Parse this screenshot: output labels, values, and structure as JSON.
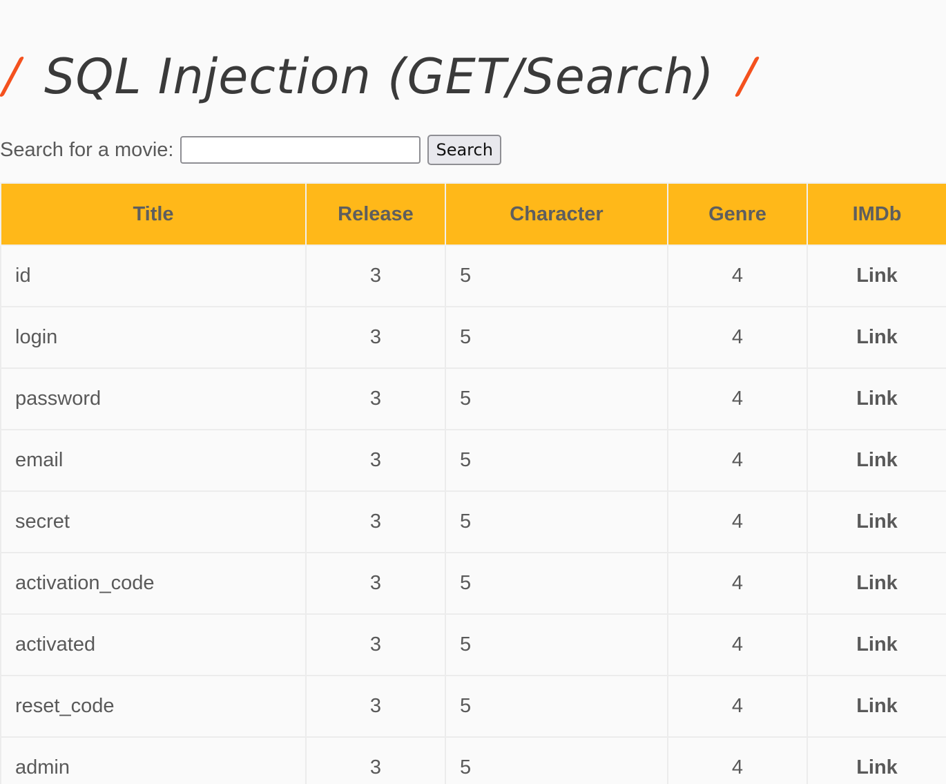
{
  "header": {
    "title": "SQL Injection (GET/Search)"
  },
  "search": {
    "label": "Search for a movie:",
    "value": "",
    "placeholder": "",
    "button_label": "Search"
  },
  "table": {
    "columns": [
      "Title",
      "Release",
      "Character",
      "Genre",
      "IMDb"
    ],
    "rows": [
      {
        "title": "id",
        "release": "3",
        "character": "5",
        "genre": "4",
        "imdb": "Link"
      },
      {
        "title": "login",
        "release": "3",
        "character": "5",
        "genre": "4",
        "imdb": "Link"
      },
      {
        "title": "password",
        "release": "3",
        "character": "5",
        "genre": "4",
        "imdb": "Link"
      },
      {
        "title": "email",
        "release": "3",
        "character": "5",
        "genre": "4",
        "imdb": "Link"
      },
      {
        "title": "secret",
        "release": "3",
        "character": "5",
        "genre": "4",
        "imdb": "Link"
      },
      {
        "title": "activation_code",
        "release": "3",
        "character": "5",
        "genre": "4",
        "imdb": "Link"
      },
      {
        "title": "activated",
        "release": "3",
        "character": "5",
        "genre": "4",
        "imdb": "Link"
      },
      {
        "title": "reset_code",
        "release": "3",
        "character": "5",
        "genre": "4",
        "imdb": "Link"
      },
      {
        "title": "admin",
        "release": "3",
        "character": "5",
        "genre": "4",
        "imdb": "Link"
      }
    ]
  },
  "colors": {
    "accent_slash": "#f4511e",
    "table_header": "#ffb819",
    "text": "#595959",
    "background": "#fafafa"
  }
}
